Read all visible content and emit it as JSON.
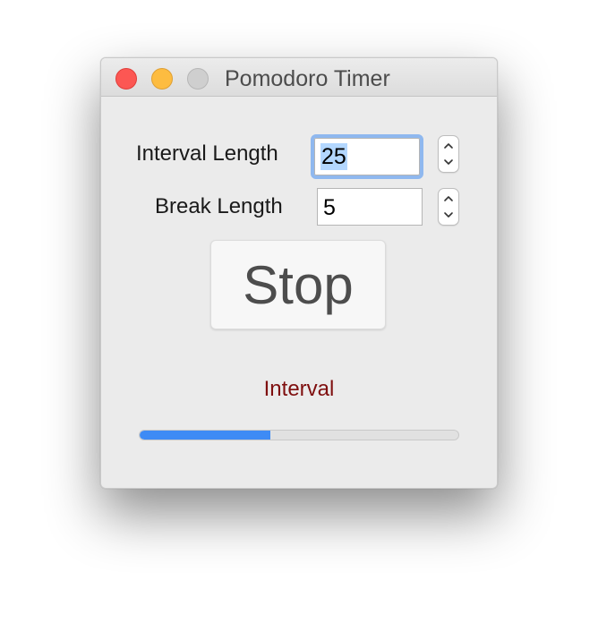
{
  "window": {
    "title": "Pomodoro Timer"
  },
  "interval": {
    "label": "Interval Length",
    "value": "25"
  },
  "break": {
    "label": "Break Length",
    "value": "5"
  },
  "control": {
    "button_label": "Stop"
  },
  "status": {
    "text": "Interval",
    "color": "#7f0f0f"
  },
  "progress": {
    "fraction": 0.41,
    "fill_color": "#3e8bf5"
  },
  "icons": {
    "close": "close-button",
    "minimize": "minimize-button",
    "zoom": "zoom-button",
    "stepper_up": "chevron-up-icon",
    "stepper_down": "chevron-down-icon"
  }
}
